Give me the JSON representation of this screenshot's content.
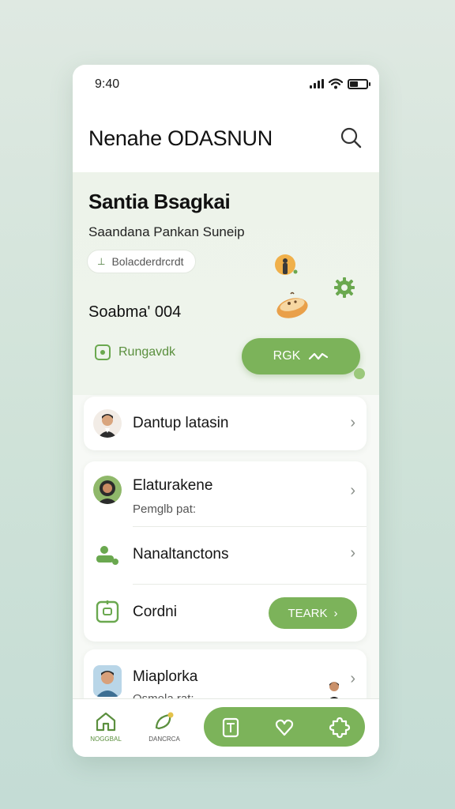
{
  "status_bar": {
    "time": "9:40"
  },
  "header": {
    "title": "Nenahe ODASNUN",
    "search_icon": "search-icon"
  },
  "hero": {
    "name": "Santia Bsagkai",
    "subtitle": "Saandana Pankan Suneip",
    "chip_label": "Bolacderdrcrdt",
    "count_label": "Soabma' 004",
    "tag_label": "Rungavdk",
    "cta_label": "RGK",
    "accent": "#7cb35a"
  },
  "list": {
    "card1": {
      "title": "Dantup latasin"
    },
    "card2": {
      "row1": {
        "title": "Elaturakene",
        "subtitle": "Pemglb pat:"
      },
      "row2": {
        "title": "Nanaltanctons"
      },
      "row3": {
        "title": "Cordni",
        "button_label": "TEARK"
      }
    },
    "card3": {
      "title": "Miaplorka",
      "subtitle": "Osmela rat:"
    }
  },
  "bottom_nav": {
    "item1": "NOGGBAL",
    "item2": "DANCRCA"
  }
}
